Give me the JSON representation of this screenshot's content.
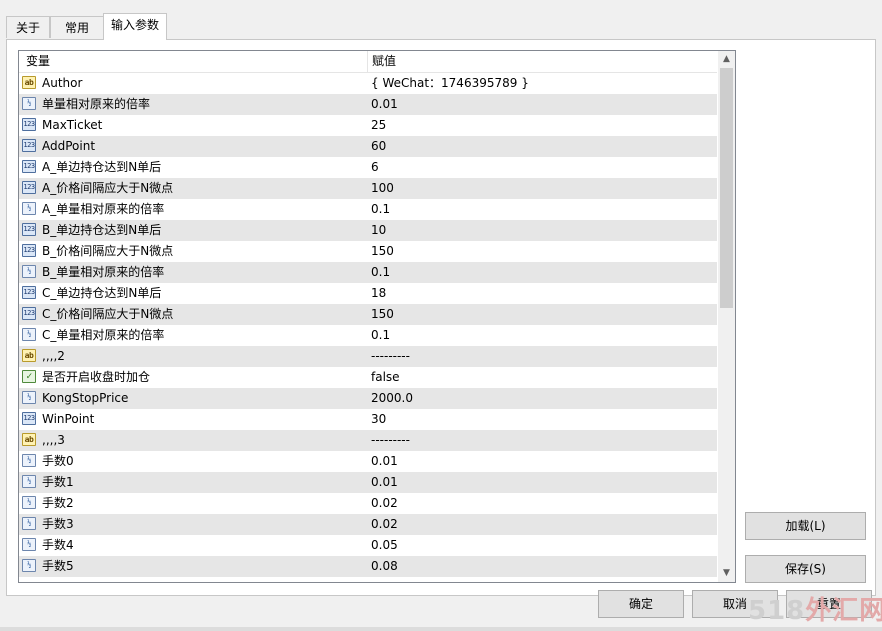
{
  "tabs": [
    {
      "label": "关于",
      "active": false
    },
    {
      "label": "常用",
      "active": false
    },
    {
      "label": "输入参数",
      "active": true
    }
  ],
  "grid": {
    "columns": {
      "variable": "变量",
      "value": "赋值"
    },
    "rows": [
      {
        "icon": "string-type-icon",
        "name": "Author",
        "value": "{ WeChat：1746395789 }"
      },
      {
        "icon": "double-type-icon",
        "name": "单量相对原来的倍率",
        "value": "0.01"
      },
      {
        "icon": "integer-type-icon",
        "name": "MaxTicket",
        "value": "25"
      },
      {
        "icon": "integer-type-icon",
        "name": "AddPoint",
        "value": "60"
      },
      {
        "icon": "integer-type-icon",
        "name": "A_单边持仓达到N单后",
        "value": "6"
      },
      {
        "icon": "integer-type-icon",
        "name": "A_价格间隔应大于N微点",
        "value": "100"
      },
      {
        "icon": "double-type-icon",
        "name": "A_单量相对原来的倍率",
        "value": "0.1"
      },
      {
        "icon": "integer-type-icon",
        "name": "B_单边持仓达到N单后",
        "value": "10"
      },
      {
        "icon": "integer-type-icon",
        "name": "B_价格间隔应大于N微点",
        "value": "150"
      },
      {
        "icon": "double-type-icon",
        "name": "B_单量相对原来的倍率",
        "value": "0.1"
      },
      {
        "icon": "integer-type-icon",
        "name": "C_单边持仓达到N单后",
        "value": "18"
      },
      {
        "icon": "integer-type-icon",
        "name": "C_价格间隔应大于N微点",
        "value": "150"
      },
      {
        "icon": "double-type-icon",
        "name": "C_单量相对原来的倍率",
        "value": "0.1"
      },
      {
        "icon": "string-type-icon",
        "name": ",,,,2",
        "value": "---------"
      },
      {
        "icon": "bool-type-icon",
        "name": "是否开启收盘时加仓",
        "value": "false"
      },
      {
        "icon": "double-type-icon",
        "name": "KongStopPrice",
        "value": "2000.0"
      },
      {
        "icon": "integer-type-icon",
        "name": "WinPoint",
        "value": "30"
      },
      {
        "icon": "string-type-icon",
        "name": ",,,,3",
        "value": "---------"
      },
      {
        "icon": "double-type-icon",
        "name": "手数0",
        "value": "0.01"
      },
      {
        "icon": "double-type-icon",
        "name": "手数1",
        "value": "0.01"
      },
      {
        "icon": "double-type-icon",
        "name": "手数2",
        "value": "0.02"
      },
      {
        "icon": "double-type-icon",
        "name": "手数3",
        "value": "0.02"
      },
      {
        "icon": "double-type-icon",
        "name": "手数4",
        "value": "0.05"
      },
      {
        "icon": "double-type-icon",
        "name": "手数5",
        "value": "0.08"
      }
    ]
  },
  "buttons": {
    "load": "加载(L)",
    "save": "保存(S)",
    "ok": "确定",
    "cancel": "取消",
    "reset": "重置"
  },
  "watermark": {
    "digits": "518",
    "text": "外汇网"
  },
  "icon_glyphs": {
    "string-type-icon": "ab",
    "integer-type-icon": "123",
    "double-type-icon": "½",
    "bool-type-icon": "✓"
  }
}
